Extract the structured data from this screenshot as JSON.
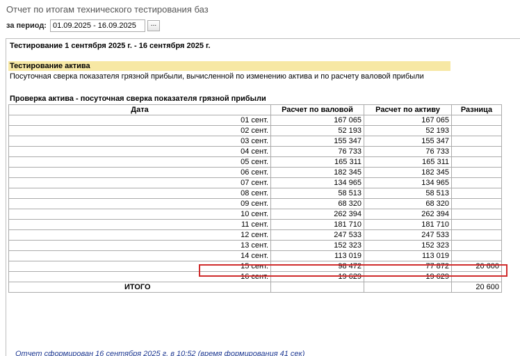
{
  "window": {
    "title": "Отчет по итогам технического тестирования баз"
  },
  "period": {
    "label": "за период:",
    "value": "01.09.2025 - 16.09.2025",
    "select_button": "..."
  },
  "report": {
    "heading": "Тестирование 1 сентября 2025 г. - 16 сентября 2025 г.",
    "section_title": "Тестирование актива",
    "section_description": "Посуточная сверка показателя грязной прибыли, вычисленной по изменению актива и по расчету валовой прибыли",
    "table_title": "Проверка актива - посуточная сверка показателя грязной прибыли",
    "columns": [
      "Дата",
      "Расчет по валовой",
      "Расчет по активу",
      "Разница"
    ],
    "rows": [
      {
        "date": "01 сент.",
        "gross": "167 065",
        "asset": "167 065",
        "diff": ""
      },
      {
        "date": "02 сент.",
        "gross": "52 193",
        "asset": "52 193",
        "diff": ""
      },
      {
        "date": "03 сент.",
        "gross": "155 347",
        "asset": "155 347",
        "diff": ""
      },
      {
        "date": "04 сент.",
        "gross": "76 733",
        "asset": "76 733",
        "diff": ""
      },
      {
        "date": "05 сент.",
        "gross": "165 311",
        "asset": "165 311",
        "diff": ""
      },
      {
        "date": "06 сент.",
        "gross": "182 345",
        "asset": "182 345",
        "diff": ""
      },
      {
        "date": "07 сент.",
        "gross": "134 965",
        "asset": "134 965",
        "diff": ""
      },
      {
        "date": "08 сент.",
        "gross": "58 513",
        "asset": "58 513",
        "diff": ""
      },
      {
        "date": "09 сент.",
        "gross": "68 320",
        "asset": "68 320",
        "diff": ""
      },
      {
        "date": "10 сент.",
        "gross": "262 394",
        "asset": "262 394",
        "diff": ""
      },
      {
        "date": "11 сент.",
        "gross": "181 710",
        "asset": "181 710",
        "diff": ""
      },
      {
        "date": "12 сент.",
        "gross": "247 533",
        "asset": "247 533",
        "diff": ""
      },
      {
        "date": "13 сент.",
        "gross": "152 323",
        "asset": "152 323",
        "diff": ""
      },
      {
        "date": "14 сент.",
        "gross": "113 019",
        "asset": "113 019",
        "diff": ""
      },
      {
        "date": "15 сент.",
        "gross": "98 472",
        "asset": "77 872",
        "diff": "20 600"
      },
      {
        "date": "16 сент.",
        "gross": "19 629",
        "asset": "19 629",
        "diff": ""
      }
    ],
    "total": {
      "label": "ИТОГО",
      "gross": "",
      "asset": "",
      "diff": "20 600"
    },
    "highlighted_row": "15 сент.",
    "footer": "Отчет сформирован 16 сентября 2025 г. в 10:52 (время формирования 41 сек)"
  },
  "colors": {
    "section_band": "#f7e8a4",
    "highlight_border": "#cf2b2b",
    "footer_text": "#1f3a93",
    "grid_border": "#aaaaaa"
  }
}
